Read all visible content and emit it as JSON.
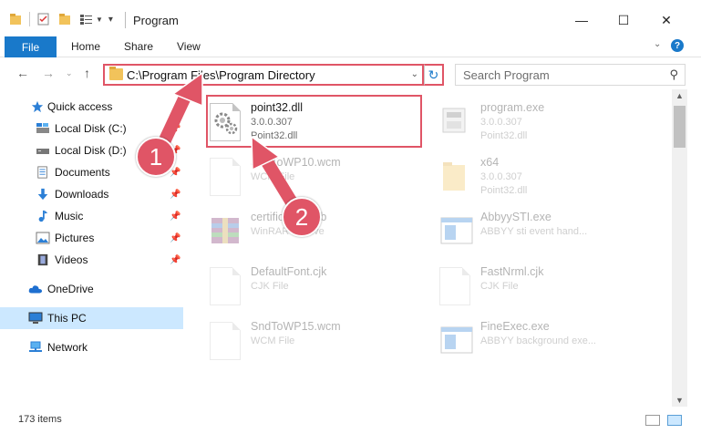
{
  "window": {
    "title": "Program",
    "minimize": "—",
    "maximize": "☐",
    "close": "✕"
  },
  "ribbon": {
    "tabs": [
      "File",
      "Home",
      "Share",
      "View"
    ],
    "help": "?"
  },
  "address_bar": {
    "path": "C:\\Program Files\\Program Directory",
    "search_placeholder": "Search Program"
  },
  "sidebar": {
    "items": [
      {
        "label": "Quick access",
        "icon": "star-icon"
      },
      {
        "label": "Local Disk (C:)",
        "icon": "drive-icon",
        "pinned": true
      },
      {
        "label": "Local Disk (D:)",
        "icon": "drive-icon",
        "pinned": true
      },
      {
        "label": "Documents",
        "icon": "documents-icon",
        "pinned": true
      },
      {
        "label": "Downloads",
        "icon": "download-icon",
        "pinned": true
      },
      {
        "label": "Music",
        "icon": "music-icon",
        "pinned": true
      },
      {
        "label": "Pictures",
        "icon": "pictures-icon",
        "pinned": true
      },
      {
        "label": "Videos",
        "icon": "videos-icon",
        "pinned": true
      },
      {
        "label": "OneDrive",
        "icon": "cloud-icon"
      },
      {
        "label": "This PC",
        "icon": "computer-icon",
        "selected": true
      },
      {
        "label": "Network",
        "icon": "network-icon"
      }
    ]
  },
  "files": [
    {
      "name": "point32.dll",
      "line2": "3.0.0.307",
      "line3": "Point32.dll",
      "icon": "dll-gear-icon",
      "highlighted": true
    },
    {
      "name": "program.exe",
      "line2": "3.0.0.307",
      "line3": "Point32.dll",
      "icon": "exe-icon"
    },
    {
      "name": "SndToWP10.wcm",
      "line2": "WCM File",
      "line3": "",
      "icon": "blank-file-icon"
    },
    {
      "name": "x64",
      "line2": "3.0.0.307",
      "line3": "Point32.dll",
      "icon": "folder-icon"
    },
    {
      "name": "certificates.cab",
      "line2": "WinRAR archive",
      "line3": "",
      "icon": "winrar-icon"
    },
    {
      "name": "AbbyySTI.exe",
      "line2": "ABBYY sti event hand...",
      "line3": "",
      "icon": "app-window-icon"
    },
    {
      "name": "DefaultFont.cjk",
      "line2": "CJK File",
      "line3": "",
      "icon": "blank-file-icon"
    },
    {
      "name": "FastNrml.cjk",
      "line2": "CJK File",
      "line3": "",
      "icon": "blank-file-icon"
    },
    {
      "name": "SndToWP15.wcm",
      "line2": "WCM File",
      "line3": "",
      "icon": "blank-file-icon"
    },
    {
      "name": "FineExec.exe",
      "line2": "ABBYY background exe...",
      "line3": "",
      "icon": "app-window-icon"
    }
  ],
  "status": {
    "item_count": "173 items"
  },
  "annotations": {
    "step1": "1",
    "step2": "2"
  },
  "colors": {
    "accent": "#1979ca",
    "highlight": "#e05566",
    "selected_bg": "#cce8ff"
  }
}
